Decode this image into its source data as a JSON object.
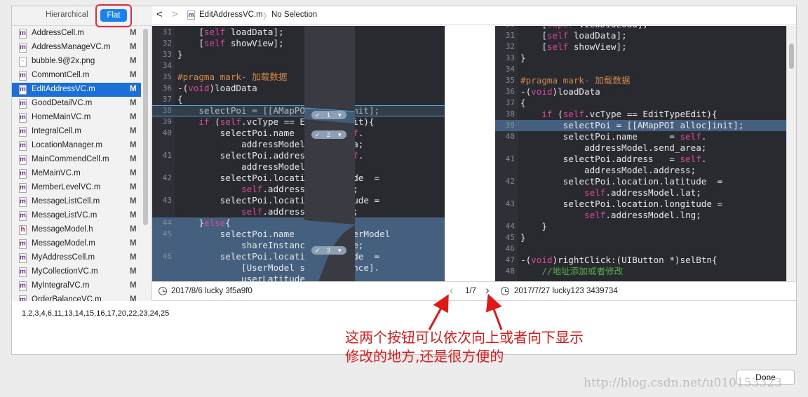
{
  "sidebar": {
    "hierarchical": "Hierarchical",
    "flat": "Flat",
    "files": [
      {
        "name": "AddressCell.m",
        "type": "m",
        "status": "M"
      },
      {
        "name": "AddressManageVC.m",
        "type": "m",
        "status": "M"
      },
      {
        "name": "bubble.9@2x.png",
        "type": "png",
        "status": "M"
      },
      {
        "name": "CommontCell.m",
        "type": "m",
        "status": "M"
      },
      {
        "name": "EditAddressVC.m",
        "type": "m",
        "status": "M",
        "selected": true
      },
      {
        "name": "GoodDetailVC.m",
        "type": "m",
        "status": "M"
      },
      {
        "name": "HomeMainVC.m",
        "type": "m",
        "status": "M"
      },
      {
        "name": "IntegralCell.m",
        "type": "m",
        "status": "M"
      },
      {
        "name": "LocationManager.m",
        "type": "m",
        "status": "M"
      },
      {
        "name": "MainCommendCell.m",
        "type": "m",
        "status": "M"
      },
      {
        "name": "MeMainVC.m",
        "type": "m",
        "status": "M"
      },
      {
        "name": "MemberLevelVC.m",
        "type": "m",
        "status": "M"
      },
      {
        "name": "MessageListCell.m",
        "type": "m",
        "status": "M"
      },
      {
        "name": "MessageListVC.m",
        "type": "m",
        "status": "M"
      },
      {
        "name": "MessageModel.h",
        "type": "h",
        "status": "M"
      },
      {
        "name": "MessageModel.m",
        "type": "m",
        "status": "M"
      },
      {
        "name": "MyAddressCell.m",
        "type": "m",
        "status": "M"
      },
      {
        "name": "MyCollectionVC.m",
        "type": "m",
        "status": "M"
      },
      {
        "name": "MyIntegralVC.m",
        "type": "m",
        "status": "M"
      },
      {
        "name": "OrderBalanceVC.m",
        "type": "m",
        "status": "M"
      }
    ]
  },
  "jumpbar": {
    "back": "<",
    "forward": ">",
    "file": "EditAddressVC.m",
    "separator": "〉",
    "selection": "No Selection"
  },
  "left_code": [
    {
      "n": "31",
      "rows": [
        [
          [
            "    [",
            ""
          ],
          [
            "self",
            "k"
          ],
          [
            " loadData];",
            ""
          ]
        ]
      ]
    },
    {
      "n": "32",
      "rows": [
        [
          [
            "    [",
            ""
          ],
          [
            "self",
            "k"
          ],
          [
            " showView];",
            ""
          ]
        ]
      ]
    },
    {
      "n": "33",
      "rows": [
        [
          [
            "}",
            ""
          ]
        ]
      ]
    },
    {
      "n": "34",
      "rows": [
        [
          [
            "",
            ""
          ]
        ]
      ]
    },
    {
      "n": "35",
      "rows": [
        [
          [
            "#pragma mark- 加载数据",
            "p"
          ]
        ]
      ]
    },
    {
      "n": "36",
      "rows": [
        [
          [
            "-(",
            ""
          ],
          [
            "void",
            "k"
          ],
          [
            ")loadData",
            ""
          ]
        ]
      ]
    },
    {
      "n": "37",
      "rows": [
        [
          [
            "{",
            ""
          ]
        ]
      ]
    },
    {
      "n": "38",
      "hl": "outline",
      "rows": [
        [
          [
            "    selectPoi = [[AMapPOI alloc]init];",
            ""
          ]
        ]
      ]
    },
    {
      "n": "39",
      "rows": [
        [
          [
            "    ",
            ""
          ],
          [
            "if",
            "k"
          ],
          [
            " (",
            ""
          ],
          [
            "self",
            "k"
          ],
          [
            ".vcType == EditTypeEdit){",
            ""
          ]
        ]
      ]
    },
    {
      "n": "40",
      "rows": [
        [
          [
            "        selectPoi.name      = ",
            ""
          ],
          [
            "self",
            "k"
          ],
          [
            ".",
            ""
          ]
        ],
        [
          [
            "            addressModel.send_area;",
            ""
          ]
        ]
      ]
    },
    {
      "n": "41",
      "rows": [
        [
          [
            "        selectPoi.address   = ",
            ""
          ],
          [
            "self",
            "k"
          ],
          [
            ".",
            ""
          ]
        ],
        [
          [
            "            addressModel.address;",
            ""
          ]
        ]
      ]
    },
    {
      "n": "42",
      "rows": [
        [
          [
            "        selectPoi.location.latitude  =",
            ""
          ]
        ],
        [
          [
            "            ",
            ""
          ],
          [
            "self",
            "k"
          ],
          [
            ".addressModel.lat;",
            ""
          ]
        ]
      ]
    },
    {
      "n": "43",
      "rows": [
        [
          [
            "        selectPoi.location.longitude =",
            ""
          ]
        ],
        [
          [
            "            ",
            ""
          ],
          [
            "self",
            "k"
          ],
          [
            ".addressModel.lng;",
            ""
          ]
        ]
      ]
    },
    {
      "n": "44",
      "hl": "change",
      "rows": [
        [
          [
            "    }",
            ""
          ],
          [
            "else",
            "k"
          ],
          [
            "{",
            ""
          ]
        ]
      ]
    },
    {
      "n": "45",
      "hl": "change",
      "rows": [
        [
          [
            "        selectPoi.name      = [UserModel",
            ""
          ]
        ],
        [
          [
            "            shareInstance].poiName;",
            ""
          ]
        ]
      ]
    },
    {
      "n": "46",
      "hl": "change",
      "rows": [
        [
          [
            "        selectPoi.location.latitude  =",
            ""
          ]
        ],
        [
          [
            "            [UserModel shareInstance].",
            ""
          ]
        ],
        [
          [
            "            userLatitude;",
            ""
          ]
        ]
      ]
    }
  ],
  "right_code": [
    {
      "n": "30",
      "rows": [
        [
          [
            "    [",
            ""
          ],
          [
            "super",
            "k"
          ],
          [
            " viewDidLoad];",
            ""
          ]
        ]
      ]
    },
    {
      "n": "31",
      "rows": [
        [
          [
            "    [",
            ""
          ],
          [
            "self",
            "k"
          ],
          [
            " loadData];",
            ""
          ]
        ]
      ]
    },
    {
      "n": "32",
      "rows": [
        [
          [
            "    [",
            ""
          ],
          [
            "self",
            "k"
          ],
          [
            " showView];",
            ""
          ]
        ]
      ]
    },
    {
      "n": "33",
      "rows": [
        [
          [
            "}",
            ""
          ]
        ]
      ]
    },
    {
      "n": "34",
      "rows": [
        [
          [
            "",
            ""
          ]
        ]
      ]
    },
    {
      "n": "35",
      "rows": [
        [
          [
            "#pragma mark- 加载数据",
            "p"
          ]
        ]
      ]
    },
    {
      "n": "36",
      "rows": [
        [
          [
            "-(",
            ""
          ],
          [
            "void",
            "k"
          ],
          [
            ")loadData",
            ""
          ]
        ]
      ]
    },
    {
      "n": "37",
      "rows": [
        [
          [
            "{",
            ""
          ]
        ]
      ]
    },
    {
      "n": "38",
      "rows": [
        [
          [
            "    ",
            ""
          ],
          [
            "if",
            "k"
          ],
          [
            " (",
            ""
          ],
          [
            "self",
            "k"
          ],
          [
            ".vcType == EditTypeEdit){",
            ""
          ]
        ]
      ]
    },
    {
      "n": "39",
      "hl": "change",
      "rows": [
        [
          [
            "        selectPoi = [[AMapPOI alloc]init];",
            ""
          ]
        ]
      ]
    },
    {
      "n": "40",
      "rows": [
        [
          [
            "        selectPoi.name      = ",
            ""
          ],
          [
            "self",
            "k"
          ],
          [
            ".",
            ""
          ]
        ],
        [
          [
            "            addressModel.send_area;",
            ""
          ]
        ]
      ]
    },
    {
      "n": "41",
      "rows": [
        [
          [
            "        selectPoi.address   = ",
            ""
          ],
          [
            "self",
            "k"
          ],
          [
            ".",
            ""
          ]
        ],
        [
          [
            "            addressModel.address;",
            ""
          ]
        ]
      ]
    },
    {
      "n": "42",
      "rows": [
        [
          [
            "        selectPoi.location.latitude  =",
            ""
          ]
        ],
        [
          [
            "            ",
            ""
          ],
          [
            "self",
            "k"
          ],
          [
            ".addressModel.lat;",
            ""
          ]
        ]
      ]
    },
    {
      "n": "43",
      "rows": [
        [
          [
            "        selectPoi.location.longitude =",
            ""
          ]
        ],
        [
          [
            "            ",
            ""
          ],
          [
            "self",
            "k"
          ],
          [
            ".addressModel.lng;",
            ""
          ]
        ]
      ]
    },
    {
      "n": "44",
      "rows": [
        [
          [
            "    }",
            ""
          ]
        ]
      ]
    },
    {
      "n": "45",
      "rows": [
        [
          [
            "}",
            ""
          ]
        ]
      ]
    },
    {
      "n": "46",
      "rows": [
        [
          [
            "",
            ""
          ]
        ]
      ]
    },
    {
      "n": "47",
      "rows": [
        [
          [
            "-(",
            ""
          ],
          [
            "void",
            "k"
          ],
          [
            ")rightClick:(UIButton *)selBtn{",
            ""
          ]
        ]
      ]
    },
    {
      "n": "48",
      "rows": [
        [
          [
            "    //地址添加或者修改",
            "c"
          ]
        ]
      ]
    }
  ],
  "changes": [
    {
      "label": "1",
      "icon": "check-icon"
    },
    {
      "label": "2",
      "icon": "check-icon"
    },
    {
      "label": "3",
      "icon": "check-icon"
    }
  ],
  "bottom": {
    "left_commit": "2017/8/6  lucky  3f5a9f0",
    "prev": "‹",
    "counter": "1/7",
    "next": "›",
    "right_commit": "2017/7/27  lucky123  3439734"
  },
  "selected_lines": "1,2,3,4,6,11,13,14,15,16,17,20,22,23,24,25",
  "annotation": {
    "line1": "这两个按钮可以依次向上或者向下显示",
    "line2": "修改的地方,还是很方便的"
  },
  "done": "Done",
  "watermark": "http://blog.csdn.net/u010153323",
  "colors": {
    "accent": "#1a82f0",
    "keyword": "#d9489d",
    "pragma": "#d0884a",
    "comment": "#55b046",
    "change": "#44607e",
    "annotation": "#e01818"
  }
}
